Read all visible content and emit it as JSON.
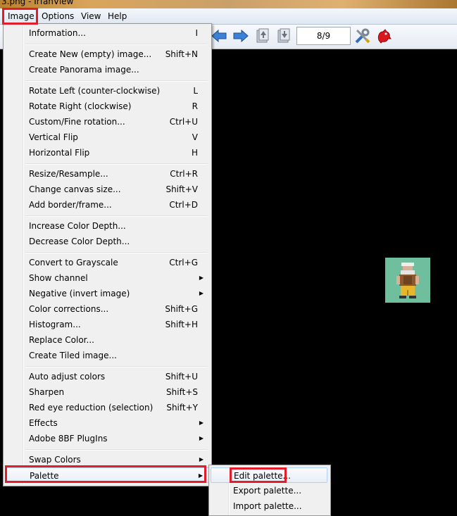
{
  "window": {
    "title": "3.png - IrfanView"
  },
  "menubar": {
    "items": [
      "Image",
      "Options",
      "View",
      "Help"
    ]
  },
  "toolbar": {
    "page_counter": "8/9"
  },
  "image_menu": {
    "information": {
      "label": "Information...",
      "shortcut": "I"
    },
    "create_new": {
      "label": "Create New (empty) image...",
      "shortcut": "Shift+N"
    },
    "create_panorama": {
      "label": "Create Panorama image...",
      "shortcut": ""
    },
    "rotate_left": {
      "label": "Rotate Left (counter-clockwise)",
      "shortcut": "L"
    },
    "rotate_right": {
      "label": "Rotate Right (clockwise)",
      "shortcut": "R"
    },
    "custom_rotation": {
      "label": "Custom/Fine rotation...",
      "shortcut": "Ctrl+U"
    },
    "vertical_flip": {
      "label": "Vertical Flip",
      "shortcut": "V"
    },
    "horizontal_flip": {
      "label": "Horizontal Flip",
      "shortcut": "H"
    },
    "resize": {
      "label": "Resize/Resample...",
      "shortcut": "Ctrl+R"
    },
    "canvas_size": {
      "label": "Change canvas size...",
      "shortcut": "Shift+V"
    },
    "add_border": {
      "label": "Add border/frame...",
      "shortcut": "Ctrl+D"
    },
    "increase_depth": {
      "label": "Increase Color Depth...",
      "shortcut": ""
    },
    "decrease_depth": {
      "label": "Decrease Color Depth...",
      "shortcut": ""
    },
    "grayscale": {
      "label": "Convert to Grayscale",
      "shortcut": "Ctrl+G"
    },
    "show_channel": {
      "label": "Show channel",
      "shortcut": ""
    },
    "negative": {
      "label": "Negative (invert image)",
      "shortcut": ""
    },
    "color_corrections": {
      "label": "Color corrections...",
      "shortcut": "Shift+G"
    },
    "histogram": {
      "label": "Histogram...",
      "shortcut": "Shift+H"
    },
    "replace_color": {
      "label": "Replace Color...",
      "shortcut": ""
    },
    "tiled_image": {
      "label": "Create Tiled image...",
      "shortcut": ""
    },
    "auto_adjust": {
      "label": "Auto adjust colors",
      "shortcut": "Shift+U"
    },
    "sharpen": {
      "label": "Sharpen",
      "shortcut": "Shift+S"
    },
    "red_eye": {
      "label": "Red eye reduction (selection)",
      "shortcut": "Shift+Y"
    },
    "effects": {
      "label": "Effects",
      "shortcut": ""
    },
    "plugins": {
      "label": "Adobe 8BF PlugIns",
      "shortcut": ""
    },
    "swap_colors": {
      "label": "Swap Colors",
      "shortcut": ""
    },
    "palette": {
      "label": "Palette",
      "shortcut": ""
    }
  },
  "palette_menu": {
    "edit": "Edit palette...",
    "export": "Export palette...",
    "import": "Import palette..."
  },
  "colors": {
    "highlight_box": "#e11d2a",
    "menu_bg": "#f0f0f0",
    "viewer_bg": "#000000",
    "sprite_bg": "#6fbf9e"
  }
}
